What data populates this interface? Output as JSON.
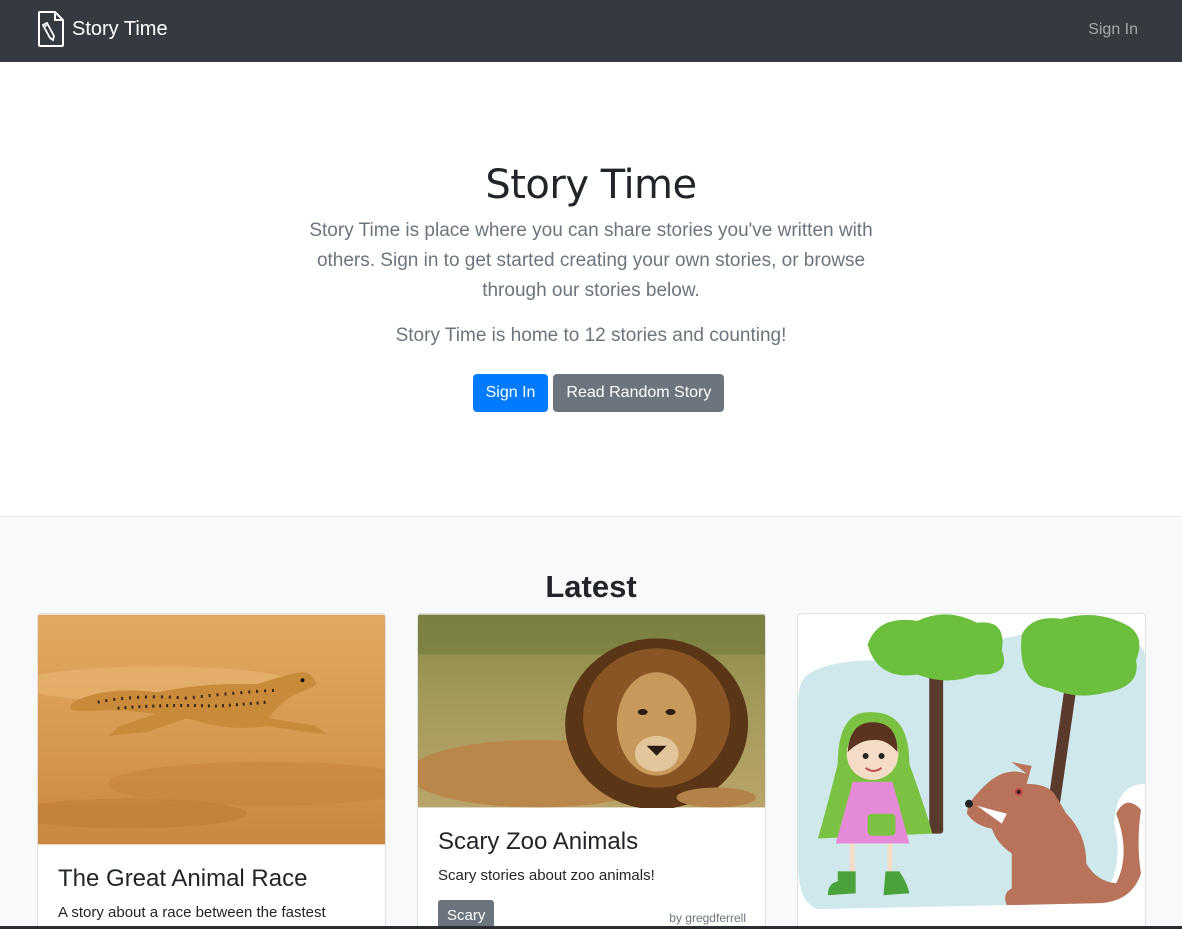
{
  "navbar": {
    "brand": "Story Time",
    "signin_link": "Sign In"
  },
  "hero": {
    "title": "Story Time",
    "lead": "Story Time is place where you can share stories you've written with others. Sign in to get started creating your own stories, or browse through our stories below.",
    "count_text": "Story Time is home to 12 stories and counting!",
    "signin_button": "Sign In",
    "random_button": "Read Random Story"
  },
  "latest": {
    "heading": "Latest",
    "cards": [
      {
        "title": "The Great Animal Race",
        "description": "A story about a race between the fastest",
        "image": "cheetah-running-photo"
      },
      {
        "title": "Scary Zoo Animals",
        "description": "Scary stories about zoo animals!",
        "tag": "Scary",
        "author": "by gregdferrell",
        "image": "lion-lying-photo"
      },
      {
        "title": "",
        "image": "red-riding-hood-and-wolf-cartoon"
      }
    ]
  },
  "colors": {
    "navbar_bg": "#343a40",
    "primary": "#007bff",
    "secondary": "#6c757d",
    "section_bg": "#f8f9fa"
  }
}
